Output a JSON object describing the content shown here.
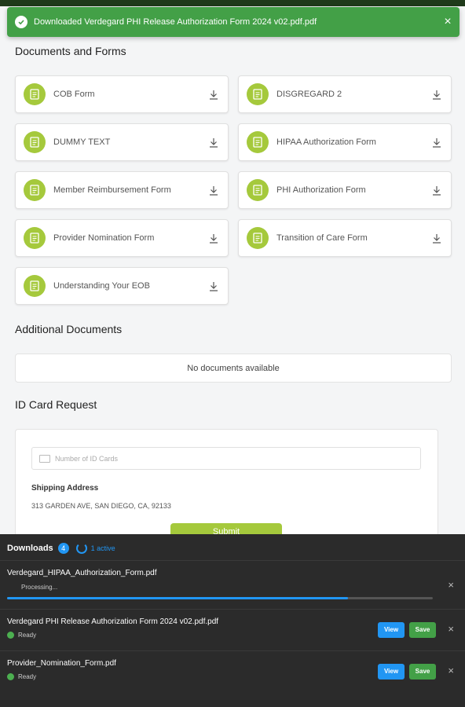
{
  "toast": {
    "message": "Downloaded Verdegard PHI Release Authorization Form 2024 v02.pdf.pdf",
    "close": "×"
  },
  "documents": {
    "heading": "Documents and Forms",
    "items": [
      {
        "label": "COB Form"
      },
      {
        "label": "DISGREGARD 2"
      },
      {
        "label": "DUMMY TEXT"
      },
      {
        "label": "HIPAA Authorization Form"
      },
      {
        "label": "Member Reimbursement Form"
      },
      {
        "label": "PHI Authorization Form"
      },
      {
        "label": "Provider Nomination Form"
      },
      {
        "label": "Transition of Care Form"
      },
      {
        "label": "Understanding Your EOB"
      }
    ]
  },
  "additional": {
    "heading": "Additional Documents",
    "empty": "No documents available"
  },
  "id_card": {
    "heading": "ID Card Request",
    "placeholder": "Number of ID Cards",
    "shipping_label": "Shipping Address",
    "shipping_address": "313 GARDEN AVE, SAN DIEGO, CA, 92133",
    "submit": "Submit"
  },
  "downloads": {
    "title": "Downloads",
    "count": "4",
    "active": "1 active",
    "items": [
      {
        "filename": "Verdegard_HIPAA_Authorization_Form.pdf",
        "status": "Processing...",
        "progress": 0.8
      },
      {
        "filename": "Verdegard PHI Release Authorization Form 2024 v02.pdf.pdf",
        "status": "Ready",
        "view": "View",
        "save": "Save"
      },
      {
        "filename": "Provider_Nomination_Form.pdf",
        "status": "Ready",
        "view": "View",
        "save": "Save"
      }
    ],
    "close": "×"
  },
  "colors": {
    "accent_green": "#a5c93c",
    "toast_green": "#43a047",
    "blue": "#2196f3",
    "panel_dark": "#2b2b2b"
  }
}
